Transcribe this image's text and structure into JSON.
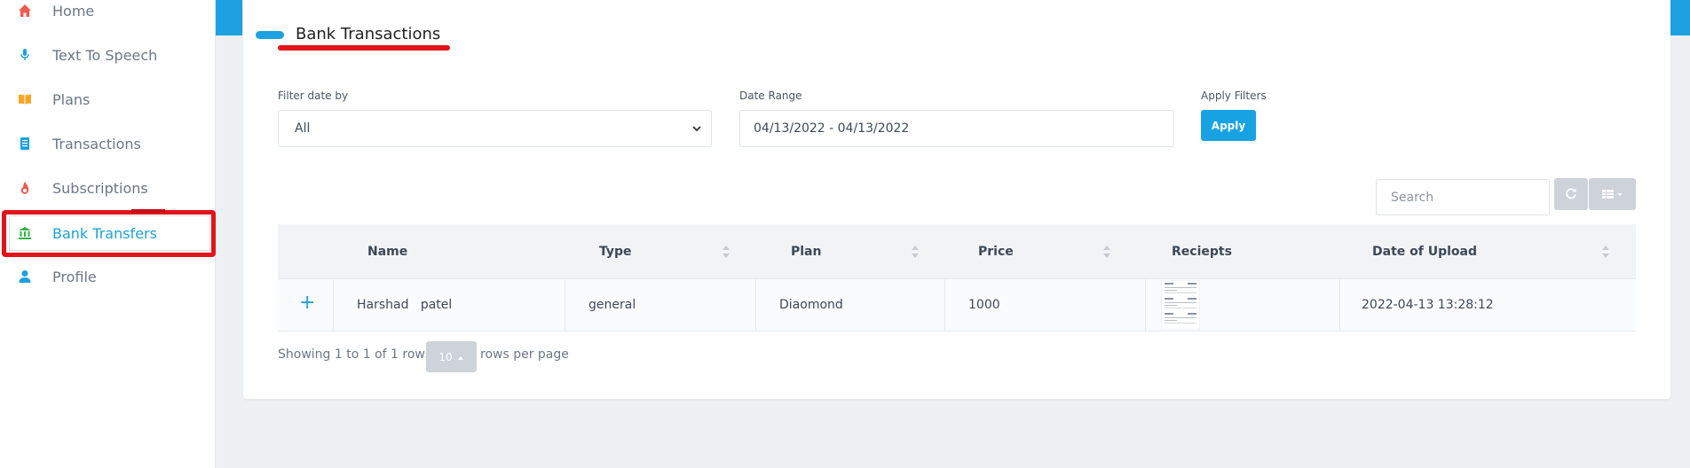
{
  "sidebar": {
    "items": [
      {
        "label": "Home",
        "icon": "home-icon",
        "color": "#f05b4f"
      },
      {
        "label": "Text To Speech",
        "icon": "microphone-icon",
        "color": "#1da1e0"
      },
      {
        "label": "Plans",
        "icon": "book-icon",
        "color": "#f5a623"
      },
      {
        "label": "Transactions",
        "icon": "document-icon",
        "color": "#1da1e0"
      },
      {
        "label": "Subscriptions",
        "icon": "flame-icon",
        "color": "#f05b4f"
      },
      {
        "label": "Bank Transfers",
        "icon": "bank-icon",
        "color": "#2fb344",
        "active": true
      },
      {
        "label": "Profile",
        "icon": "user-icon",
        "color": "#1da1e0"
      }
    ]
  },
  "page": {
    "title": "Bank Transactions"
  },
  "filters": {
    "filter_date_label": "Filter date by",
    "filter_date_value": "All",
    "date_range_label": "Date Range",
    "date_range_value": "04/13/2022 - 04/13/2022",
    "apply_label": "Apply Filters",
    "apply_button": "Apply"
  },
  "toolbar": {
    "search_placeholder": "Search",
    "refresh_icon": "refresh-icon",
    "columns_icon": "table-columns-icon"
  },
  "table": {
    "columns": [
      "Name",
      "Type",
      "Plan",
      "Price",
      "Reciepts",
      "Date of Upload"
    ],
    "rows": [
      {
        "expand": "+",
        "name": "Harshad   patel",
        "type": "general",
        "plan": "Diaomond",
        "price": "1000",
        "receipt": "receipt-thumbnail",
        "date": "2022-04-13 13:28:12"
      }
    ]
  },
  "pagination": {
    "showing": "Showing 1 to 1 of 1 rows",
    "page_size": "10",
    "rows_per_page": "rows per page"
  },
  "colors": {
    "accent": "#1da1e0",
    "highlight": "#e3131b"
  }
}
